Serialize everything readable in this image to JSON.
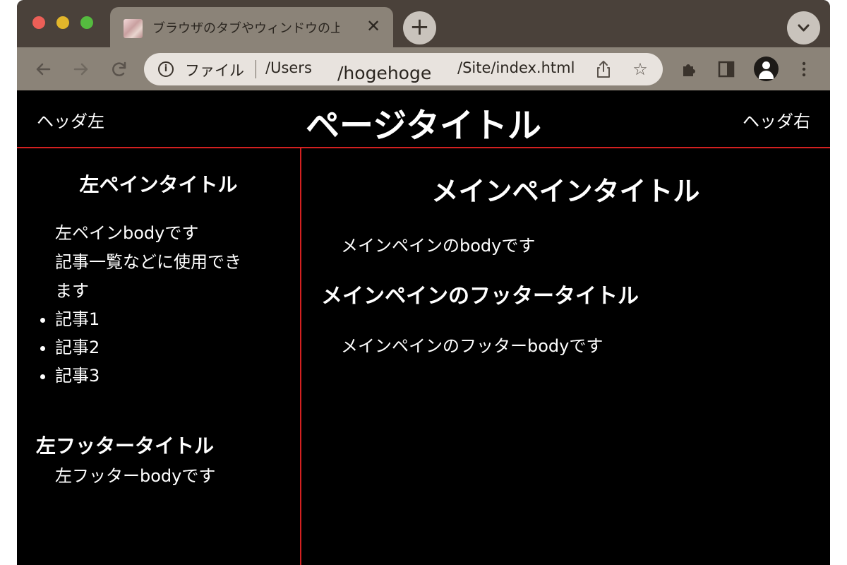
{
  "browser": {
    "tab": {
      "title": "ブラウザのタブやウィンドウの上部",
      "close_glyph": "✕"
    },
    "new_tab_glyph": "+",
    "address_bar": {
      "scheme_label": "ファイル",
      "url_part1": "/Users",
      "url_part2": "/hogehoge",
      "url_part3": "/Site/index.html"
    },
    "icons": [
      "back-icon",
      "forward-icon",
      "reload-icon",
      "info-icon",
      "share-icon",
      "star-icon",
      "extensions-icon",
      "side-panel-icon",
      "profile-icon",
      "menu-icon",
      "tab-search-icon"
    ]
  },
  "page": {
    "header": {
      "left": "ヘッダ左",
      "title": "ページタイトル",
      "right": "ヘッダ右"
    },
    "left_pane": {
      "title": "左ペインタイトル",
      "body_lines": [
        "左ペインbodyです",
        "記事一覧などに使用でき",
        "ます"
      ],
      "items": [
        "記事1",
        "記事2",
        "記事3"
      ],
      "footer_title": "左フッタータイトル",
      "footer_body": "左フッターbodyです"
    },
    "main_pane": {
      "title": "メインペインタイトル",
      "body": "メインペインのbodyです",
      "footer_title": "メインペインのフッタータイトル",
      "footer_body": "メインペインのフッターbodyです"
    }
  },
  "colors": {
    "divider": "#d42020",
    "page_background": "#000000"
  }
}
